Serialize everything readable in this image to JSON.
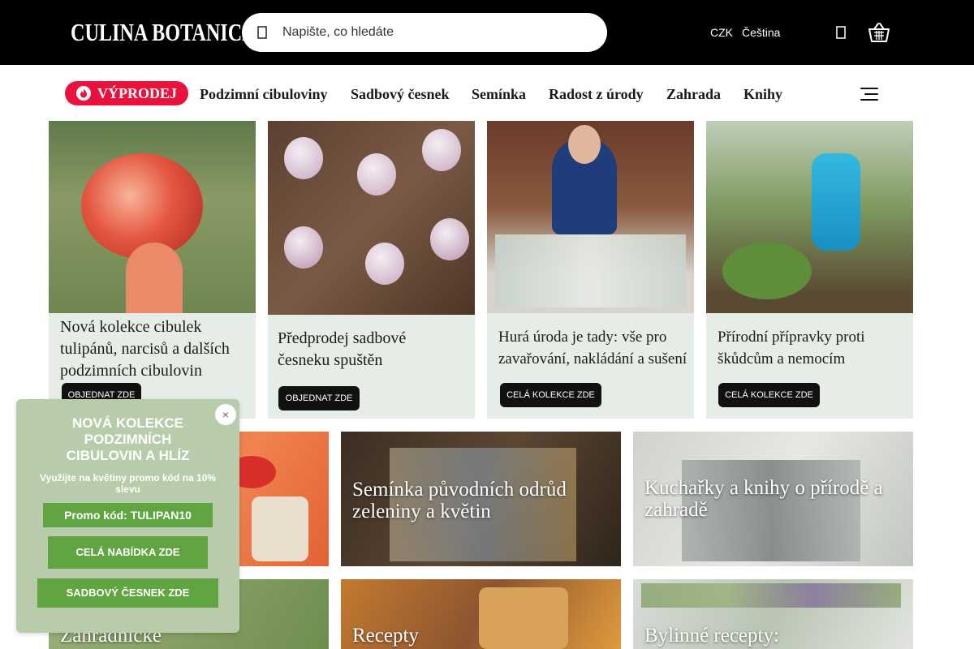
{
  "header": {
    "logo": "CULINA BOTANICA",
    "search_placeholder": "Napište, co hledáte",
    "currency": "CZK",
    "language": "Čeština"
  },
  "nav": {
    "sale": "VÝPRODEJ",
    "items": [
      "Podzimní cibuloviny",
      "Sadbový česnek",
      "Semínka",
      "Radost z úrody",
      "Zahrada",
      "Knihy"
    ]
  },
  "banners": [
    {
      "text": "Nová kolekce cibulek tulipánů, narcisů a dalších podzimních cibulovin",
      "button": "OBJEDNAT ZDE"
    },
    {
      "text": "Předprodej sadbové česneku spuštěn",
      "button": "OBJEDNAT ZDE"
    },
    {
      "text": "Hurá úroda je tady: vše pro zavařování, nakládání a sušení",
      "button": "CELÁ KOLEKCE ZDE"
    },
    {
      "text": "Přírodní přípravky proti škůdcům a nemocím",
      "button": "CELÁ KOLEKCE ZDE"
    }
  ],
  "tiles": [
    {
      "text": "Semínka původních odrůd zeleniny a květin"
    },
    {
      "text": "Kuchařky a knihy o přírodě a zahradě"
    },
    {
      "text": "Zahradnické"
    },
    {
      "text": "Recepty"
    },
    {
      "text": "Bylinné recepty:"
    }
  ],
  "popup": {
    "title": "NOVÁ KOLEKCE PODZIMNÍCH CIBULOVIN A HLÍZ",
    "subtitle": "Využijte na květiny promo kód na 10% slevu",
    "promo": "Promo kód: TULIPAN10",
    "btn1": "CELÁ NABÍDKA ZDE",
    "btn2": "SADBOVÝ ČESNEK ZDE",
    "close": "×"
  },
  "colors": {
    "sale": "#e8123d",
    "popup_bg": "#b8ccab",
    "popup_button": "#61a543",
    "caption_bg": "#e6ece6"
  }
}
